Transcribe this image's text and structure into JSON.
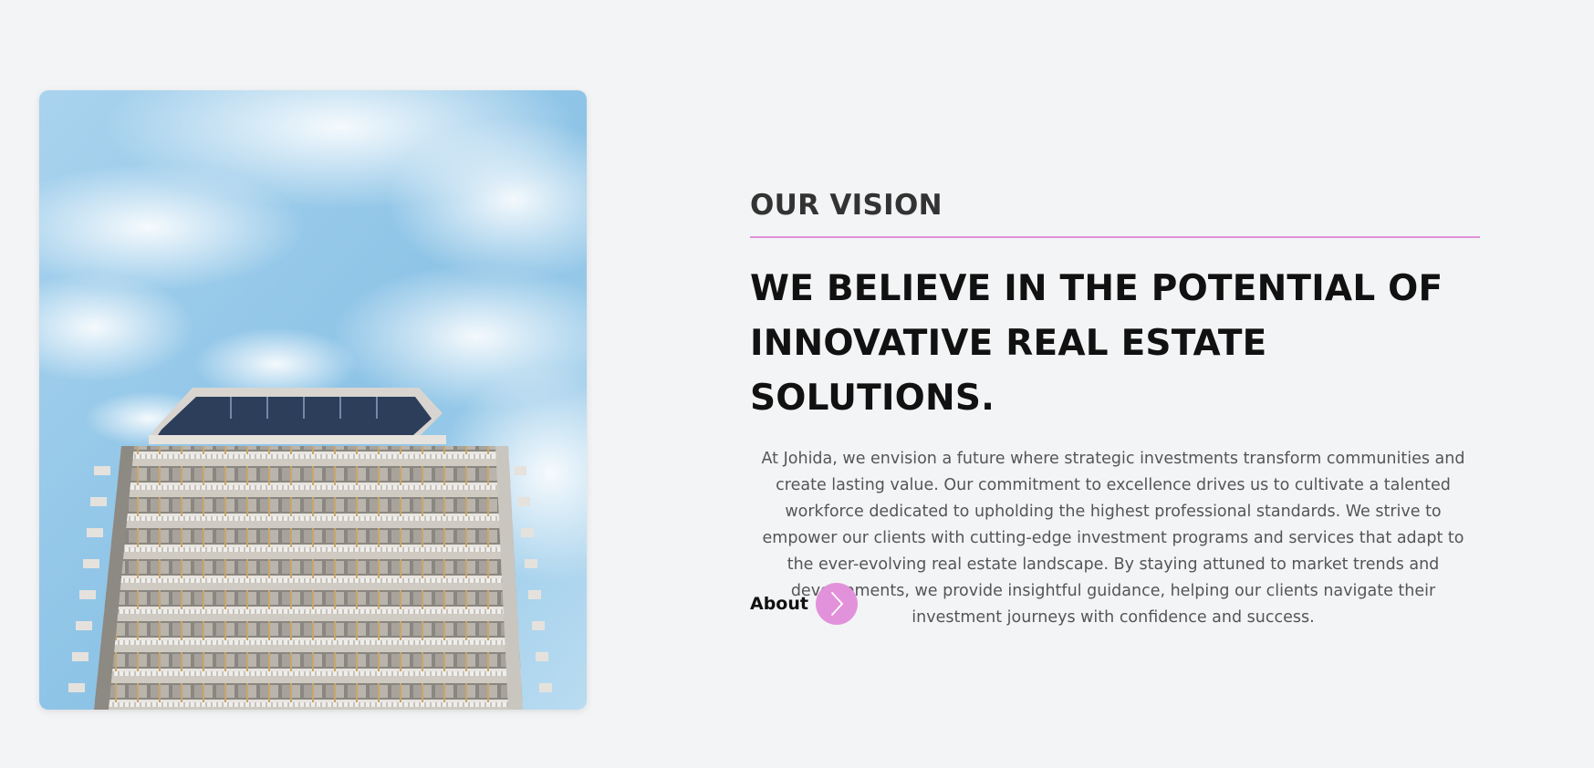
{
  "vision": {
    "eyebrow": "OUR VISION",
    "headline": "WE BELIEVE IN THE POTENTIAL OF INNOVATIVE REAL ESTATE SOLUTIONS.",
    "body": "At Johida, we envision a future where strategic investments transform communities and create lasting value. Our commitment to excellence drives us to cultivate a talented workforce dedicated to upholding the highest professional standards. We strive to empower our clients with cutting-edge investment programs and services that adapt to the ever-evolving real estate landscape. By staying attuned to market trends and developments, we provide insightful guidance, helping our clients navigate their investment journeys with confidence and success.",
    "cta_label": "About",
    "cta_icon": "chevron-right-icon"
  },
  "image": {
    "subject": "building-photo"
  },
  "colors": {
    "accent": "#e292da",
    "background": "#f3f4f6",
    "heading": "#111111",
    "eyebrow": "#333333",
    "body": "#555555"
  }
}
